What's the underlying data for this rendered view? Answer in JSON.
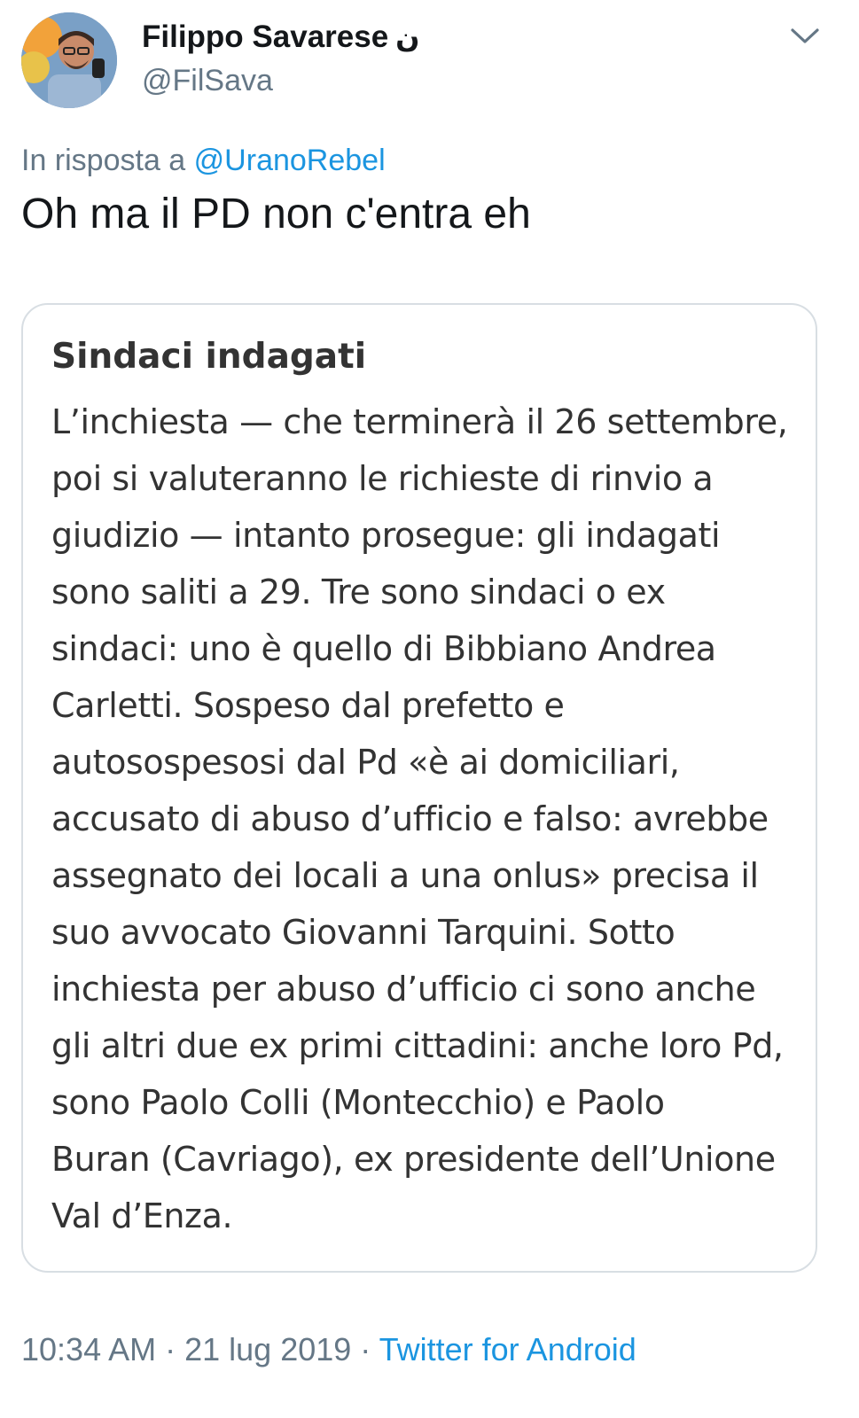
{
  "author": {
    "display_name": "Filippo Savarese",
    "name_suffix": "ن",
    "handle": "@FilSava"
  },
  "reply": {
    "prefix": "In risposta a",
    "mention": "@UranoRebel"
  },
  "tweet": {
    "text": "Oh ma il PD non c'entra eh"
  },
  "quoted_article": {
    "title": "Sindaci indagati",
    "lines": [
      "L’inchiesta — che terminerà il 26 settembre,",
      "poi si valuteranno le richieste di rinvio a",
      "giudizio — intanto prosegue: gli indagati",
      "sono saliti a 29. Tre sono sindaci o ex",
      "sindaci: uno è quello di Bibbiano Andrea",
      "Carletti. Sospeso dal prefetto e",
      "autosospesosi dal Pd «è ai domiciliari,",
      "accusato di abuso d’ufficio e falso: avrebbe",
      "assegnato dei locali a una onlus» precisa il",
      "suo avvocato Giovanni Tarquini. Sotto",
      "inchiesta per abuso d’ufficio ci sono anche",
      "gli altri due ex primi cittadini: anche loro Pd,",
      "sono Paolo Colli (Montecchio) e Paolo",
      "Buran (Cavriago), ex presidente dell’Unione",
      "Val d’Enza."
    ]
  },
  "meta": {
    "time": "10:34 AM",
    "separator": " · ",
    "date": "21 lug 2019",
    "separator2": " · ",
    "source": "Twitter for Android"
  },
  "icons": {
    "menu": "chevron-down-icon",
    "avatar": "profile-photo"
  },
  "colors": {
    "link": "#1b95e0",
    "secondary_text": "#657786",
    "border": "#d8dee3"
  }
}
